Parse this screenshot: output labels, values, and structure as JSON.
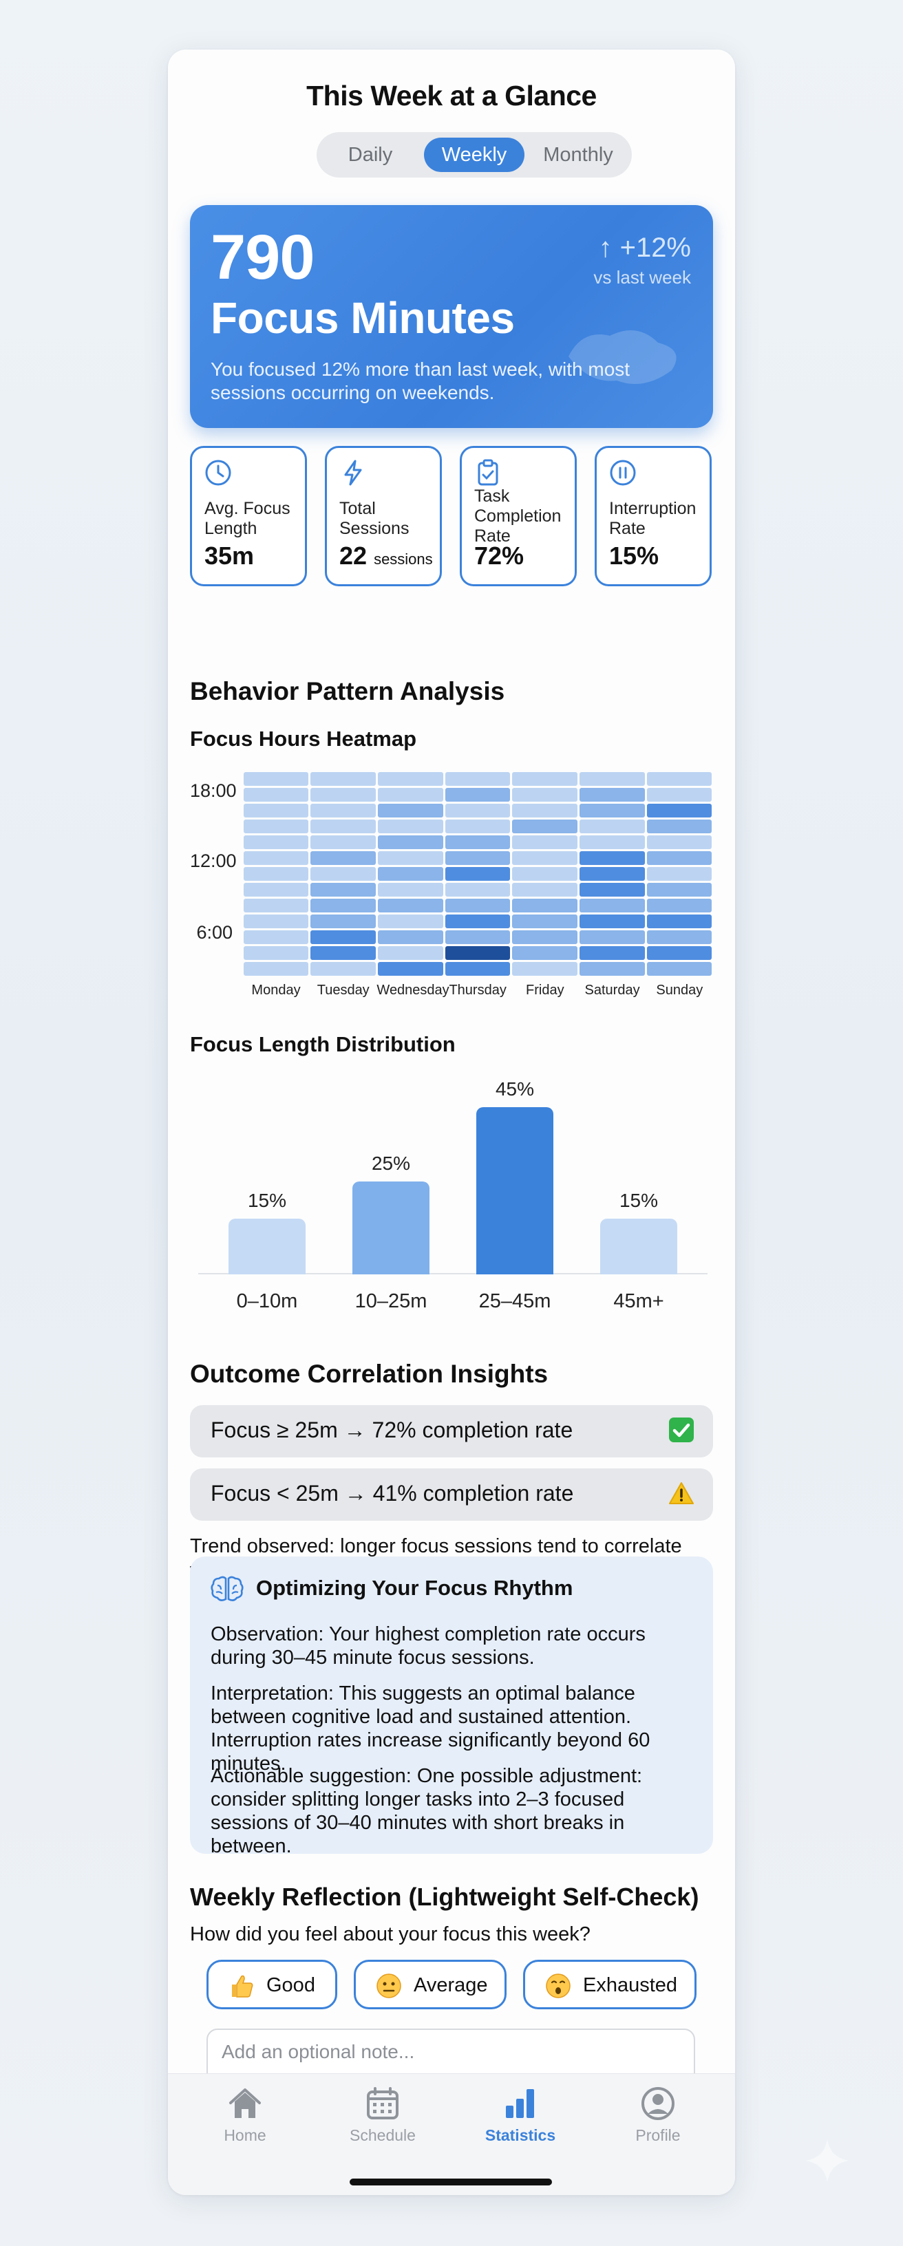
{
  "page": {
    "title": "This Week at a Glance"
  },
  "period_tabs": [
    {
      "label": "Daily",
      "active": false
    },
    {
      "label": "Weekly",
      "active": true
    },
    {
      "label": "Monthly",
      "active": false
    }
  ],
  "hero": {
    "value": "790",
    "label": "Focus Minutes",
    "delta": "↑ +12%",
    "delta_note": "vs last week",
    "description": "You focused 12% more than last week, with most sessions occurring on weekends.",
    "color": "#3b82db"
  },
  "stats": [
    {
      "icon": "clock-icon",
      "label": "Avg. Focus Length",
      "value": "35m",
      "unit": ""
    },
    {
      "icon": "lightning-icon",
      "label": "Total Sessions",
      "value": "22",
      "unit": "sessions"
    },
    {
      "icon": "clipboard-check-icon",
      "label": "Task Completion Rate",
      "value": "72%",
      "unit": ""
    },
    {
      "icon": "pause-icon",
      "label": "Interruption Rate",
      "value": "15%",
      "unit": ""
    }
  ],
  "behavior": {
    "title": "Behavior Pattern Analysis",
    "heatmap_title": "Focus Hours Heatmap",
    "y_labels": [
      "18:00",
      "12:00",
      "6:00"
    ],
    "days": [
      "Monday",
      "Tuesday",
      "Wednesday",
      "Thursday",
      "Friday",
      "Saturday",
      "Sunday"
    ],
    "intensity": [
      [
        1,
        1,
        1,
        1,
        1,
        1,
        1,
        1,
        1,
        1,
        1,
        1,
        1
      ],
      [
        1,
        1,
        1,
        1,
        1,
        2,
        1,
        2,
        2,
        2,
        3,
        3,
        1
      ],
      [
        1,
        1,
        2,
        1,
        2,
        1,
        2,
        1,
        2,
        1,
        2,
        1,
        3
      ],
      [
        1,
        2,
        1,
        1,
        2,
        2,
        3,
        1,
        2,
        3,
        2,
        4,
        3
      ],
      [
        1,
        1,
        1,
        2,
        1,
        1,
        1,
        1,
        2,
        2,
        2,
        2,
        1
      ],
      [
        1,
        2,
        2,
        1,
        1,
        3,
        3,
        3,
        2,
        3,
        2,
        3,
        2
      ],
      [
        1,
        1,
        3,
        2,
        1,
        2,
        1,
        2,
        2,
        3,
        2,
        3,
        2
      ]
    ]
  },
  "distribution": {
    "title": "Focus Length Distribution",
    "chart_data": {
      "type": "bar",
      "categories": [
        "0–10m",
        "10–25m",
        "25–45m",
        "45m+"
      ],
      "values": [
        15,
        25,
        45,
        15
      ],
      "labels": [
        "15%",
        "25%",
        "45%",
        "15%"
      ],
      "ylim": [
        0,
        50
      ],
      "colors": [
        "#c5daf5",
        "#7fb0ec",
        "#3b82db",
        "#c5daf5"
      ]
    }
  },
  "correlation": {
    "title": "Outcome Correlation Insights",
    "rows": [
      {
        "text": "Focus ≥ 25m → 72% completion rate",
        "icon": "check-icon"
      },
      {
        "text": "Focus < 25m → 41% completion rate",
        "icon": "warning-icon"
      }
    ],
    "trend": "Trend observed: longer focus sessions tend to correlate with higher task completion rates."
  },
  "insight": {
    "title": "Optimizing Your Focus Rhythm",
    "observation": "Observation: Your highest completion rate occurs during 30–45 minute focus sessions.",
    "interpretation": "Interpretation: This suggests an optimal balance between cognitive load and sustained attention. Interruption rates increase significantly beyond 60 minutes.",
    "suggestion": "Actionable suggestion: One possible adjustment: consider splitting longer tasks into 2–3 focused sessions of 30–40 minutes with short breaks in between."
  },
  "reflection": {
    "title": "Weekly Reflection (Lightweight Self-Check)",
    "question": "How did you feel about your focus this week?",
    "options": [
      {
        "emoji": "thumbs-up-icon",
        "label": "Good"
      },
      {
        "emoji": "neutral-face-icon",
        "label": "Average"
      },
      {
        "emoji": "surprised-face-icon",
        "label": "Exhausted"
      }
    ],
    "note_placeholder": "Add an optional note..."
  },
  "tabbar": [
    {
      "icon": "home-icon",
      "label": "Home",
      "active": false
    },
    {
      "icon": "calendar-icon",
      "label": "Schedule",
      "active": false
    },
    {
      "icon": "bar-chart-icon",
      "label": "Statistics",
      "active": true
    },
    {
      "icon": "profile-icon",
      "label": "Profile",
      "active": false
    }
  ]
}
